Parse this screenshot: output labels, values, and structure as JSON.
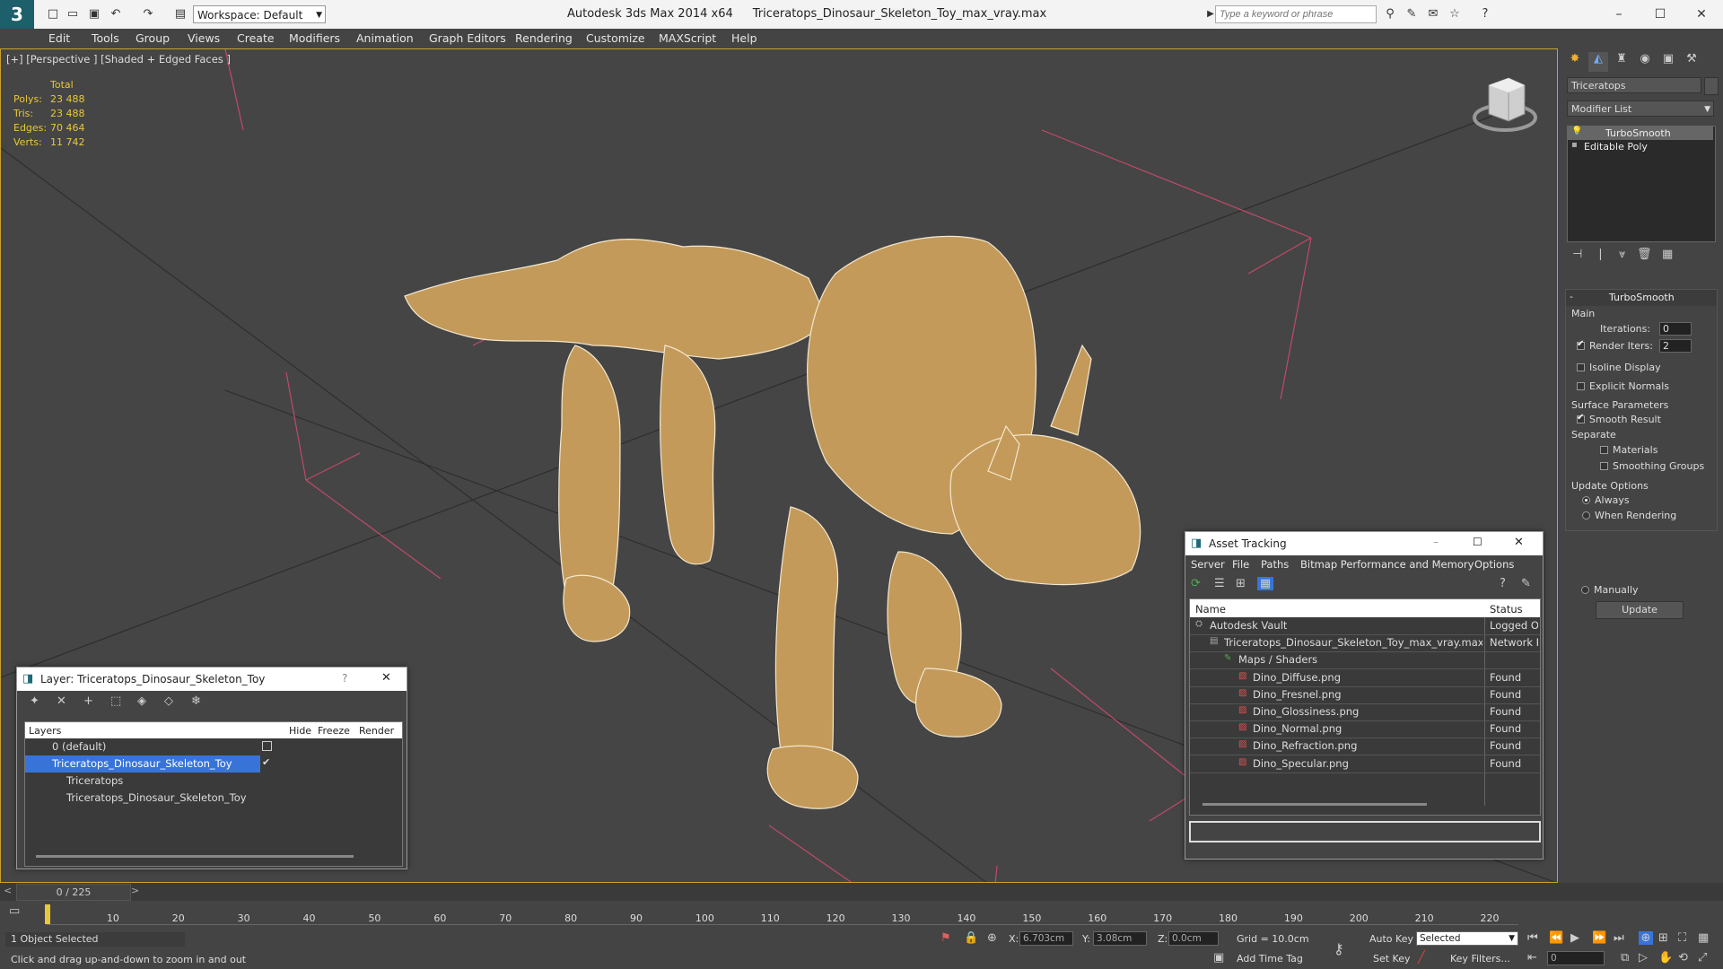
{
  "titlebar": {
    "app": "Autodesk 3ds Max  2014 x64",
    "file": "Triceratops_Dinosaur_Skeleton_Toy_max_vray.max",
    "workspace": "Workspace: Default",
    "search_placeholder": "Type a keyword or phrase"
  },
  "menu": [
    "Edit",
    "Tools",
    "Group",
    "Views",
    "Create",
    "Modifiers",
    "Animation",
    "Graph Editors",
    "Rendering",
    "Customize",
    "MAXScript",
    "Help"
  ],
  "viewport": {
    "label": "[+] [Perspective ] [Shaded + Edged Faces ]",
    "stats": {
      "header": "Total",
      "rows": [
        {
          "label": "Polys:",
          "value": "23 488"
        },
        {
          "label": "Tris:",
          "value": "23 488"
        },
        {
          "label": "Edges:",
          "value": "70 464"
        },
        {
          "label": "Verts:",
          "value": "11 742"
        }
      ]
    }
  },
  "command_panel": {
    "object_name": "Triceratops",
    "modifier_list": "Modifier List",
    "stack": [
      "TurboSmooth",
      "Editable Poly"
    ],
    "rollout_title": "TurboSmooth",
    "main_label": "Main",
    "iterations_label": "Iterations:",
    "iterations": "0",
    "render_iters_label": "Render Iters:",
    "render_iters": "2",
    "isoline": "Isoline Display",
    "explicit": "Explicit Normals",
    "surface_label": "Surface Parameters",
    "smooth_result": "Smooth Result",
    "separate_label": "Separate",
    "materials": "Materials",
    "smoothing_groups": "Smoothing Groups",
    "update_options": "Update Options",
    "always": "Always",
    "when_rendering": "When Rendering",
    "manually": "Manually",
    "update_button": "Update"
  },
  "layer_dialog": {
    "title": "Layer: Triceratops_Dinosaur_Skeleton_Toy",
    "help": "?",
    "columns": [
      "Layers",
      "Hide",
      "Freeze",
      "Render"
    ],
    "rows": [
      "0 (default)",
      "Triceratops_Dinosaur_Skeleton_Toy",
      "Triceratops",
      "Triceratops_Dinosaur_Skeleton_Toy"
    ]
  },
  "asset_dialog": {
    "title": "Asset Tracking",
    "menu": [
      "Server",
      "File",
      "Paths",
      "Bitmap Performance and Memory",
      "Options"
    ],
    "columns": [
      "Name",
      "Status"
    ],
    "rows": [
      {
        "name": "Autodesk Vault",
        "status": "Logged Ou"
      },
      {
        "name": "Triceratops_Dinosaur_Skeleton_Toy_max_vray.max",
        "status": "Network P"
      },
      {
        "name": "Maps / Shaders",
        "status": ""
      },
      {
        "name": "Dino_Diffuse.png",
        "status": "Found"
      },
      {
        "name": "Dino_Fresnel.png",
        "status": "Found"
      },
      {
        "name": "Dino_Glossiness.png",
        "status": "Found"
      },
      {
        "name": "Dino_Normal.png",
        "status": "Found"
      },
      {
        "name": "Dino_Refraction.png",
        "status": "Found"
      },
      {
        "name": "Dino_Specular.png",
        "status": "Found"
      }
    ]
  },
  "timeline": {
    "frame": "0 / 225",
    "ticks": [
      "10",
      "20",
      "30",
      "40",
      "50",
      "60",
      "70",
      "80",
      "90",
      "100",
      "110",
      "120",
      "130",
      "140",
      "150",
      "160",
      "170",
      "180",
      "190",
      "200",
      "210",
      "220"
    ]
  },
  "status": {
    "selected": "1 Object Selected",
    "prompt": "Click and drag up-and-down to zoom in and out",
    "x_label": "X:",
    "x": "6.703cm",
    "y_label": "Y:",
    "y": "3.08cm",
    "z_label": "Z:",
    "z": "0.0cm",
    "grid": "Grid = 10.0cm",
    "auto_key": "Auto Key",
    "set_key": "Set Key",
    "selected_dropdown": "Selected",
    "key_filters": "Key Filters...",
    "add_time_tag": "Add Time Tag",
    "frame_field": "0"
  }
}
